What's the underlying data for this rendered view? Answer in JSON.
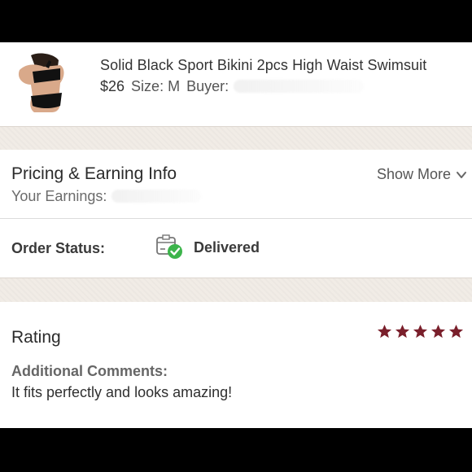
{
  "product": {
    "title": "Solid Black Sport Bikini 2pcs High Waist Swimsuit",
    "price": "$26",
    "size": "Size: M",
    "buyer_label": "Buyer:"
  },
  "pricing": {
    "title": "Pricing & Earning Info",
    "earnings_label": "Your Earnings:",
    "show_more": "Show More"
  },
  "order": {
    "status_label": "Order Status:",
    "status_value": "Delivered",
    "status_icon": "package-delivered-icon"
  },
  "rating": {
    "title": "Rating",
    "stars": 5,
    "star_color": "#7a1f2b",
    "comments_label": "Additional Comments:",
    "comment": "It fits perfectly and looks amazing!"
  },
  "colors": {
    "delivered_check": "#3cb44b",
    "band": "#f1ece6"
  }
}
